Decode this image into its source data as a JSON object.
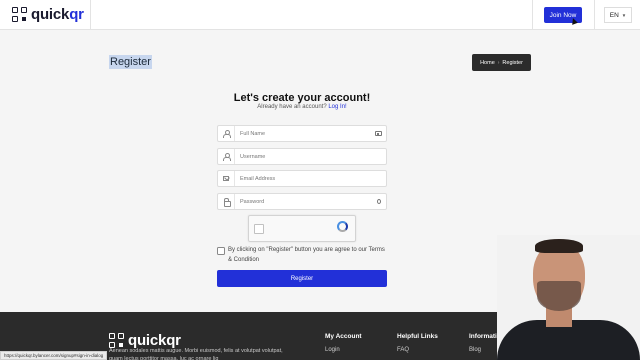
{
  "header": {
    "logo_prefix": "quick",
    "logo_suffix": "qr",
    "join_label": "Join Now",
    "lang_label": "EN"
  },
  "page": {
    "title": "Register",
    "breadcrumb": [
      "Home",
      "Register"
    ]
  },
  "form": {
    "headline": "Let's create your account!",
    "subline": "Already have an account?",
    "login_link": "Log In!",
    "fields": {
      "full_name": {
        "placeholder": "Full Name",
        "value": ""
      },
      "username": {
        "placeholder": "Username",
        "value": ""
      },
      "email": {
        "placeholder": "Email Address",
        "value": ""
      },
      "password": {
        "placeholder": "Password",
        "value": ""
      }
    },
    "terms_text": "By clicking on \"Register\" button you are agree to our Terms & Condition",
    "submit_label": "Register"
  },
  "footer": {
    "logo_prefix": "quick",
    "logo_suffix": "qr",
    "about": "Aenean sodales mattis augue. Morbi euismod, felis at volutpat volutpat, quam lectus porttitor massa, luc ac ornare lig",
    "columns": [
      {
        "title": "My Account",
        "link": "Login"
      },
      {
        "title": "Helpful Links",
        "link": "FAQ"
      },
      {
        "title": "Informati",
        "link": "Blog"
      }
    ]
  },
  "status_url": "https://quickqr.bylancer.com/signup#sign-in-dialog",
  "colors": {
    "accent": "#2230d8",
    "footer_bg": "#2b2b2b",
    "breadcrumb_bg": "#2b2b2b"
  },
  "icons": [
    "logo-qr-icon",
    "user-icon",
    "mail-icon",
    "lock-icon",
    "id-card-icon",
    "eye-icon",
    "recaptcha-icon",
    "chevron-down-icon"
  ]
}
